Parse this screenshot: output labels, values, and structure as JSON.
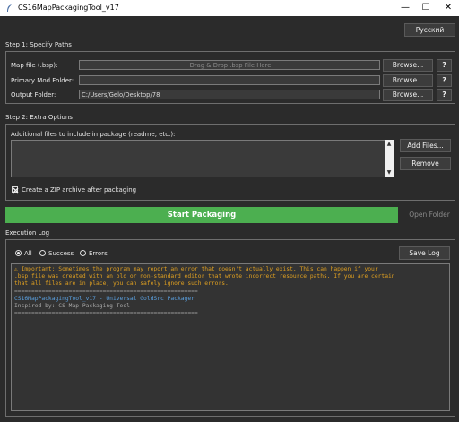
{
  "window": {
    "title": "CS16MapPackagingTool_v17",
    "minimize": "—",
    "maximize": "☐",
    "close": "✕"
  },
  "language_button": "Русский",
  "step1": {
    "title": "Step 1: Specify Paths",
    "map_label": "Map file (.bsp):",
    "map_placeholder": "Drag & Drop .bsp File Here",
    "mod_label": "Primary Mod Folder:",
    "mod_value": "",
    "output_label": "Output Folder:",
    "output_value": "C:/Users/Gelo/Desktop/78",
    "browse": "Browse...",
    "help": "?"
  },
  "step2": {
    "title": "Step 2: Extra Options",
    "additional_label": "Additional files to include in package (readme, etc.):",
    "add_files": "Add Files...",
    "remove": "Remove",
    "zip_label": "Create a ZIP archive after packaging",
    "zip_checked": true
  },
  "actions": {
    "start": "Start Packaging",
    "open_folder": "Open Folder"
  },
  "log": {
    "title": "Execution Log",
    "filters": [
      "All",
      "Success",
      "Errors"
    ],
    "selected_filter": "All",
    "save": "Save Log",
    "lines": [
      {
        "cls": "warn",
        "text": "⚠ Important: Sometimes the program may report an error that doesn't actually exist. This can happen if your"
      },
      {
        "cls": "warn",
        "text": ".bsp file was created with an old or non-standard editor that wrote incorrect resource paths. If you are certain"
      },
      {
        "cls": "warn",
        "text": "that all files are in place, you can safely ignore such errors."
      },
      {
        "cls": "sep",
        "text": "======================================================"
      },
      {
        "cls": "blue",
        "text": "CS16MapPackagingTool_v17 - Universal GoldSrc Packager"
      },
      {
        "cls": "grey",
        "text": "Inspired by: CS Map Packaging Tool"
      },
      {
        "cls": "sep",
        "text": "======================================================"
      }
    ]
  }
}
